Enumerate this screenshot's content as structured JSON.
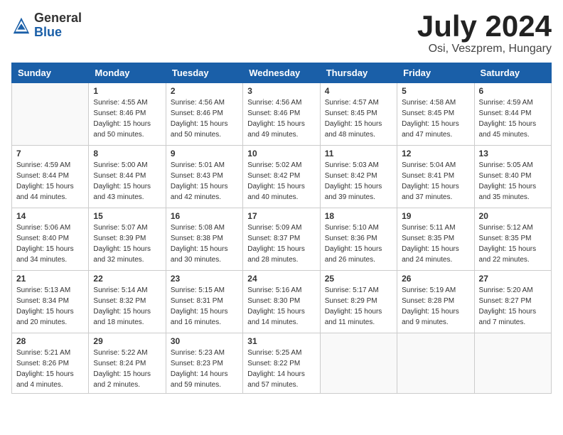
{
  "header": {
    "logo_general": "General",
    "logo_blue": "Blue",
    "month_title": "July 2024",
    "location": "Osi, Veszprem, Hungary"
  },
  "days_of_week": [
    "Sunday",
    "Monday",
    "Tuesday",
    "Wednesday",
    "Thursday",
    "Friday",
    "Saturday"
  ],
  "weeks": [
    [
      {
        "day": "",
        "info": ""
      },
      {
        "day": "1",
        "info": "Sunrise: 4:55 AM\nSunset: 8:46 PM\nDaylight: 15 hours\nand 50 minutes."
      },
      {
        "day": "2",
        "info": "Sunrise: 4:56 AM\nSunset: 8:46 PM\nDaylight: 15 hours\nand 50 minutes."
      },
      {
        "day": "3",
        "info": "Sunrise: 4:56 AM\nSunset: 8:46 PM\nDaylight: 15 hours\nand 49 minutes."
      },
      {
        "day": "4",
        "info": "Sunrise: 4:57 AM\nSunset: 8:45 PM\nDaylight: 15 hours\nand 48 minutes."
      },
      {
        "day": "5",
        "info": "Sunrise: 4:58 AM\nSunset: 8:45 PM\nDaylight: 15 hours\nand 47 minutes."
      },
      {
        "day": "6",
        "info": "Sunrise: 4:59 AM\nSunset: 8:44 PM\nDaylight: 15 hours\nand 45 minutes."
      }
    ],
    [
      {
        "day": "7",
        "info": "Sunrise: 4:59 AM\nSunset: 8:44 PM\nDaylight: 15 hours\nand 44 minutes."
      },
      {
        "day": "8",
        "info": "Sunrise: 5:00 AM\nSunset: 8:44 PM\nDaylight: 15 hours\nand 43 minutes."
      },
      {
        "day": "9",
        "info": "Sunrise: 5:01 AM\nSunset: 8:43 PM\nDaylight: 15 hours\nand 42 minutes."
      },
      {
        "day": "10",
        "info": "Sunrise: 5:02 AM\nSunset: 8:42 PM\nDaylight: 15 hours\nand 40 minutes."
      },
      {
        "day": "11",
        "info": "Sunrise: 5:03 AM\nSunset: 8:42 PM\nDaylight: 15 hours\nand 39 minutes."
      },
      {
        "day": "12",
        "info": "Sunrise: 5:04 AM\nSunset: 8:41 PM\nDaylight: 15 hours\nand 37 minutes."
      },
      {
        "day": "13",
        "info": "Sunrise: 5:05 AM\nSunset: 8:40 PM\nDaylight: 15 hours\nand 35 minutes."
      }
    ],
    [
      {
        "day": "14",
        "info": "Sunrise: 5:06 AM\nSunset: 8:40 PM\nDaylight: 15 hours\nand 34 minutes."
      },
      {
        "day": "15",
        "info": "Sunrise: 5:07 AM\nSunset: 8:39 PM\nDaylight: 15 hours\nand 32 minutes."
      },
      {
        "day": "16",
        "info": "Sunrise: 5:08 AM\nSunset: 8:38 PM\nDaylight: 15 hours\nand 30 minutes."
      },
      {
        "day": "17",
        "info": "Sunrise: 5:09 AM\nSunset: 8:37 PM\nDaylight: 15 hours\nand 28 minutes."
      },
      {
        "day": "18",
        "info": "Sunrise: 5:10 AM\nSunset: 8:36 PM\nDaylight: 15 hours\nand 26 minutes."
      },
      {
        "day": "19",
        "info": "Sunrise: 5:11 AM\nSunset: 8:35 PM\nDaylight: 15 hours\nand 24 minutes."
      },
      {
        "day": "20",
        "info": "Sunrise: 5:12 AM\nSunset: 8:35 PM\nDaylight: 15 hours\nand 22 minutes."
      }
    ],
    [
      {
        "day": "21",
        "info": "Sunrise: 5:13 AM\nSunset: 8:34 PM\nDaylight: 15 hours\nand 20 minutes."
      },
      {
        "day": "22",
        "info": "Sunrise: 5:14 AM\nSunset: 8:32 PM\nDaylight: 15 hours\nand 18 minutes."
      },
      {
        "day": "23",
        "info": "Sunrise: 5:15 AM\nSunset: 8:31 PM\nDaylight: 15 hours\nand 16 minutes."
      },
      {
        "day": "24",
        "info": "Sunrise: 5:16 AM\nSunset: 8:30 PM\nDaylight: 15 hours\nand 14 minutes."
      },
      {
        "day": "25",
        "info": "Sunrise: 5:17 AM\nSunset: 8:29 PM\nDaylight: 15 hours\nand 11 minutes."
      },
      {
        "day": "26",
        "info": "Sunrise: 5:19 AM\nSunset: 8:28 PM\nDaylight: 15 hours\nand 9 minutes."
      },
      {
        "day": "27",
        "info": "Sunrise: 5:20 AM\nSunset: 8:27 PM\nDaylight: 15 hours\nand 7 minutes."
      }
    ],
    [
      {
        "day": "28",
        "info": "Sunrise: 5:21 AM\nSunset: 8:26 PM\nDaylight: 15 hours\nand 4 minutes."
      },
      {
        "day": "29",
        "info": "Sunrise: 5:22 AM\nSunset: 8:24 PM\nDaylight: 15 hours\nand 2 minutes."
      },
      {
        "day": "30",
        "info": "Sunrise: 5:23 AM\nSunset: 8:23 PM\nDaylight: 14 hours\nand 59 minutes."
      },
      {
        "day": "31",
        "info": "Sunrise: 5:25 AM\nSunset: 8:22 PM\nDaylight: 14 hours\nand 57 minutes."
      },
      {
        "day": "",
        "info": ""
      },
      {
        "day": "",
        "info": ""
      },
      {
        "day": "",
        "info": ""
      }
    ]
  ]
}
